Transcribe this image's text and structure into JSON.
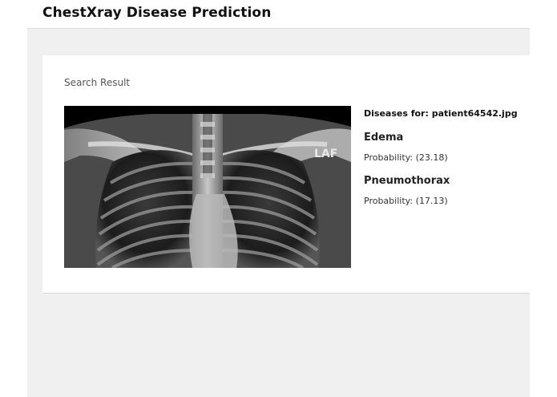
{
  "header": {
    "title": "ChestXray Disease Prediction"
  },
  "result": {
    "heading": "Search Result",
    "diseases_for_label": "Diseases for:",
    "filename": "patient64542.jpg",
    "probability_label": "Probability:",
    "diseases": [
      {
        "name": "Edema",
        "probability": "(23.18)"
      },
      {
        "name": "Pneumothorax",
        "probability": "(17.13)"
      }
    ],
    "xray_marker": "LAF"
  },
  "colors": {
    "page_background": "#ffffff",
    "main_background": "#f0f0f0",
    "card_background": "#ffffff",
    "xray_background": "#000000"
  }
}
